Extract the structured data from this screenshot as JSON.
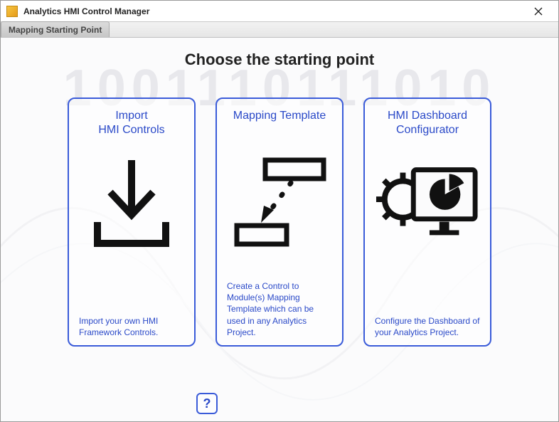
{
  "window": {
    "title": "Analytics HMI Control Manager"
  },
  "tab": {
    "label": "Mapping Starting Point"
  },
  "heading": "Choose the starting point",
  "bg_digits": "1001110111010",
  "cards": [
    {
      "title": "Import\nHMI Controls",
      "desc": "Import your own HMI Framework Controls."
    },
    {
      "title": "Mapping Template",
      "desc": "Create a Control to Module(s) Mapping Template which can be used in any Analytics Project."
    },
    {
      "title": "HMI Dashboard\nConfigurator",
      "desc": "Configure the Dashboard of your Analytics Project."
    }
  ],
  "help": {
    "label": "?"
  }
}
